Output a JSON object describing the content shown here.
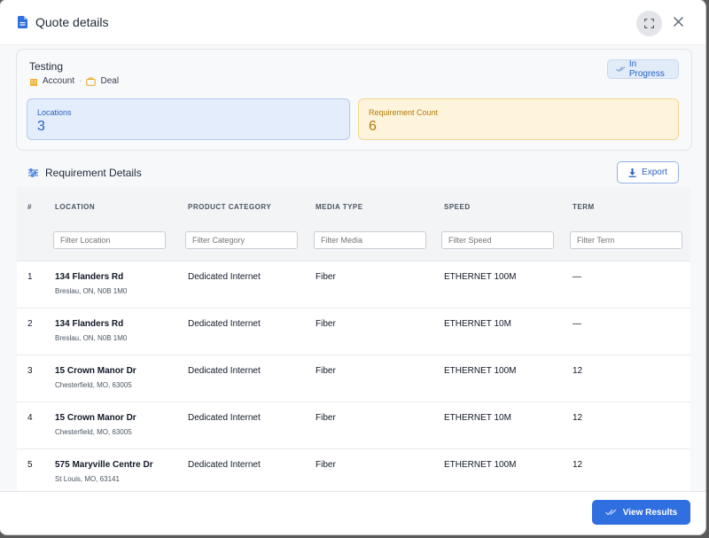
{
  "window": {
    "title": "Quote details"
  },
  "summary": {
    "name": "Testing",
    "crumb_account": "Account",
    "crumb_separator": "·",
    "crumb_deal": "Deal",
    "status": "In Progress",
    "stats": {
      "locations_label": "Locations",
      "locations_value": "3",
      "requirements_label": "Requirement Count",
      "requirements_value": "6"
    }
  },
  "section": {
    "title": "Requirement Details",
    "export_label": "Export"
  },
  "table": {
    "headers": [
      "#",
      "LOCATION",
      "PRODUCT CATEGORY",
      "MEDIA TYPE",
      "SPEED",
      "TERM"
    ],
    "filters": [
      "Filter Location",
      "Filter Category",
      "Filter Media",
      "Filter Speed",
      "Filter Term"
    ],
    "rows": [
      {
        "num": "1",
        "address": "134 Flanders Rd",
        "city": "Breslau, ON, N0B 1M0",
        "category": "Dedicated Internet",
        "media": "Fiber",
        "speed": "ETHERNET 100M",
        "term": "—"
      },
      {
        "num": "2",
        "address": "134 Flanders Rd",
        "city": "Breslau, ON, N0B 1M0",
        "category": "Dedicated Internet",
        "media": "Fiber",
        "speed": "ETHERNET 10M",
        "term": "—"
      },
      {
        "num": "3",
        "address": "15 Crown Manor Dr",
        "city": "Chesterfield, MO, 63005",
        "category": "Dedicated Internet",
        "media": "Fiber",
        "speed": "ETHERNET 100M",
        "term": "12"
      },
      {
        "num": "4",
        "address": "15 Crown Manor Dr",
        "city": "Chesterfield, MO, 63005",
        "category": "Dedicated Internet",
        "media": "Fiber",
        "speed": "ETHERNET 10M",
        "term": "12"
      },
      {
        "num": "5",
        "address": "575 Maryville Centre Dr",
        "city": "St Louis, MO, 63141",
        "category": "Dedicated Internet",
        "media": "Fiber",
        "speed": "ETHERNET 100M",
        "term": "12"
      }
    ]
  },
  "footer": {
    "view_results_label": "View Results"
  },
  "colors": {
    "accent": "#2f6fe0",
    "locations_bg": "#e3edfb",
    "requirements_bg": "#fef4dc"
  },
  "icons": [
    "document-icon",
    "expand-icon",
    "close-icon",
    "building-icon",
    "briefcase-icon",
    "double-check-icon",
    "sliders-icon",
    "download-icon"
  ]
}
